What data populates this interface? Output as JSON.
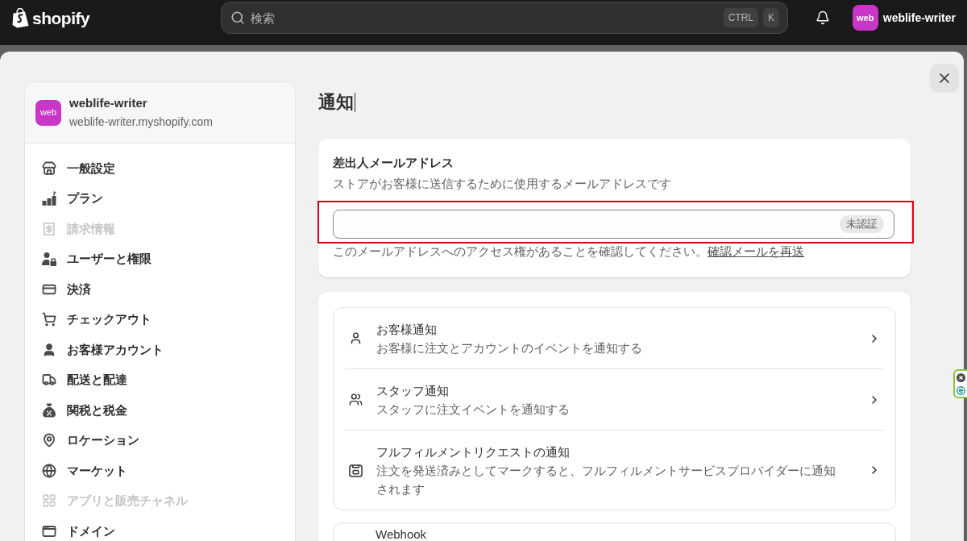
{
  "top_bar": {
    "logo": "shopify",
    "search": {
      "placeholder": "検索",
      "shortcut_keys": [
        "CTRL",
        "K"
      ]
    },
    "account": {
      "avatar": "web",
      "name": "weblife-writer"
    }
  },
  "sidebar": {
    "store": {
      "avatar": "web",
      "name": "weblife-writer",
      "domain": "weblife-writer.myshopify.com"
    },
    "items": [
      {
        "label": "一般設定",
        "disabled": false
      },
      {
        "label": "プラン",
        "disabled": false
      },
      {
        "label": "請求情報",
        "disabled": true
      },
      {
        "label": "ユーザーと権限",
        "disabled": false
      },
      {
        "label": "決済",
        "disabled": false
      },
      {
        "label": "チェックアウト",
        "disabled": false
      },
      {
        "label": "お客様アカウント",
        "disabled": false
      },
      {
        "label": "配送と配達",
        "disabled": false
      },
      {
        "label": "関税と税金",
        "disabled": false
      },
      {
        "label": "ロケーション",
        "disabled": false
      },
      {
        "label": "マーケット",
        "disabled": false
      },
      {
        "label": "アプリと販売チャネル",
        "disabled": true
      },
      {
        "label": "ドメイン",
        "disabled": false
      }
    ]
  },
  "page": {
    "title": "通知"
  },
  "sender_email": {
    "title": "差出人メールアドレス",
    "description": "ストアがお客様に送信するために使用するメールアドレスです",
    "highlighted": true,
    "status_badge": "未認証",
    "note": "このメールアドレスへのアクセス権があることを確認してください。",
    "link": "確認メールを再送"
  },
  "notifications": [
    {
      "title": "お客様通知",
      "description": "お客様に注文とアカウントのイベントを通知する"
    },
    {
      "title": "スタッフ通知",
      "description": "スタッフに注文イベントを通知する"
    },
    {
      "title": "フルフィルメントリクエストの通知",
      "description": "注文を発送済みとしてマークすると、フルフィルメントサービスプロバイダーに通知されます"
    }
  ],
  "webhooks": {
    "title": "Webhook"
  }
}
